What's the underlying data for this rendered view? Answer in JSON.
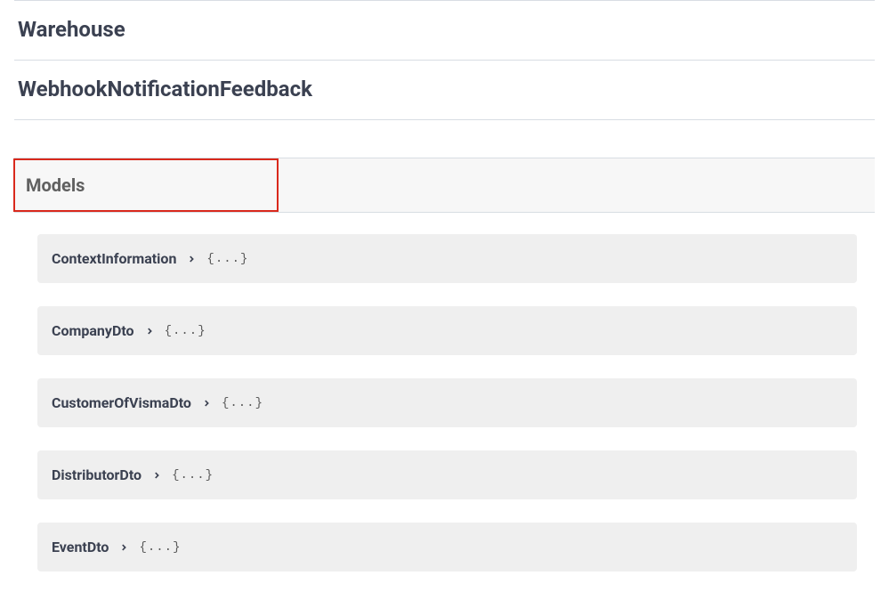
{
  "tags": [
    {
      "name": "Warehouse"
    },
    {
      "name": "WebhookNotificationFeedback"
    }
  ],
  "models_section_title": "Models",
  "collapsed_placeholder": "{...}",
  "models": [
    {
      "name": "ContextInformation"
    },
    {
      "name": "CompanyDto"
    },
    {
      "name": "CustomerOfVismaDto"
    },
    {
      "name": "DistributorDto"
    },
    {
      "name": "EventDto"
    }
  ]
}
